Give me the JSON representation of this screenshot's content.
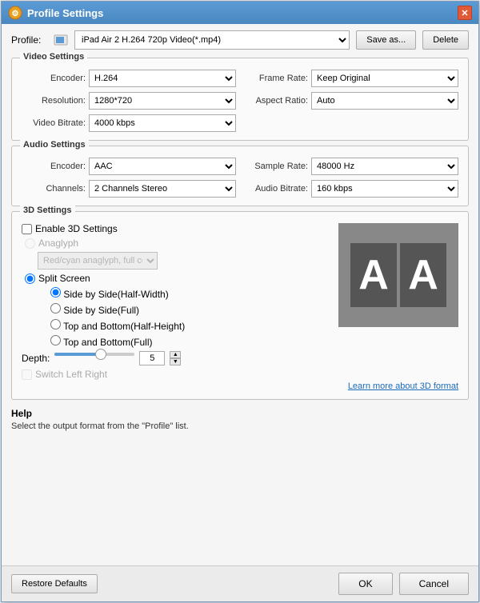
{
  "titleBar": {
    "title": "Profile Settings",
    "closeLabel": "✕"
  },
  "profileRow": {
    "label": "Profile:",
    "value": "iPad Air 2 H.264 720p Video(*.mp4)",
    "saveAsLabel": "Save as...",
    "deleteLabel": "Delete"
  },
  "videoSettings": {
    "sectionTitle": "Video Settings",
    "encoderLabel": "Encoder:",
    "encoderValue": "H.264",
    "frameRateLabel": "Frame Rate:",
    "frameRateValue": "Keep Original",
    "resolutionLabel": "Resolution:",
    "resolutionValue": "1280*720",
    "aspectRatioLabel": "Aspect Ratio:",
    "aspectRatioValue": "Auto",
    "videoBitrateLabel": "Video Bitrate:",
    "videoBitrateValue": "4000 kbps"
  },
  "audioSettings": {
    "sectionTitle": "Audio Settings",
    "encoderLabel": "Encoder:",
    "encoderValue": "AAC",
    "sampleRateLabel": "Sample Rate:",
    "sampleRateValue": "48000 Hz",
    "channelsLabel": "Channels:",
    "channelsValue": "2 Channels Stereo",
    "audioBitrateLabel": "Audio Bitrate:",
    "audioBitrateValue": "160 kbps"
  },
  "settings3D": {
    "sectionTitle": "3D Settings",
    "enableCheckboxLabel": "Enable 3D Settings",
    "anaglyphLabel": "Anaglyph",
    "anaglyphValue": "Red/cyan anaglyph, full color",
    "splitScreenLabel": "Split Screen",
    "option1": "Side by Side(Half-Width)",
    "option2": "Side by Side(Full)",
    "option3": "Top and Bottom(Half-Height)",
    "option4": "Top and Bottom(Full)",
    "depthLabel": "Depth:",
    "depthValue": "5",
    "switchLeftRightLabel": "Switch Left Right",
    "learnMoreLink": "Learn more about 3D format",
    "aaText1": "A",
    "aaText2": "A"
  },
  "help": {
    "title": "Help",
    "text": "Select the output format from the \"Profile\" list."
  },
  "footer": {
    "restoreDefaultsLabel": "Restore Defaults",
    "okLabel": "OK",
    "cancelLabel": "Cancel"
  }
}
